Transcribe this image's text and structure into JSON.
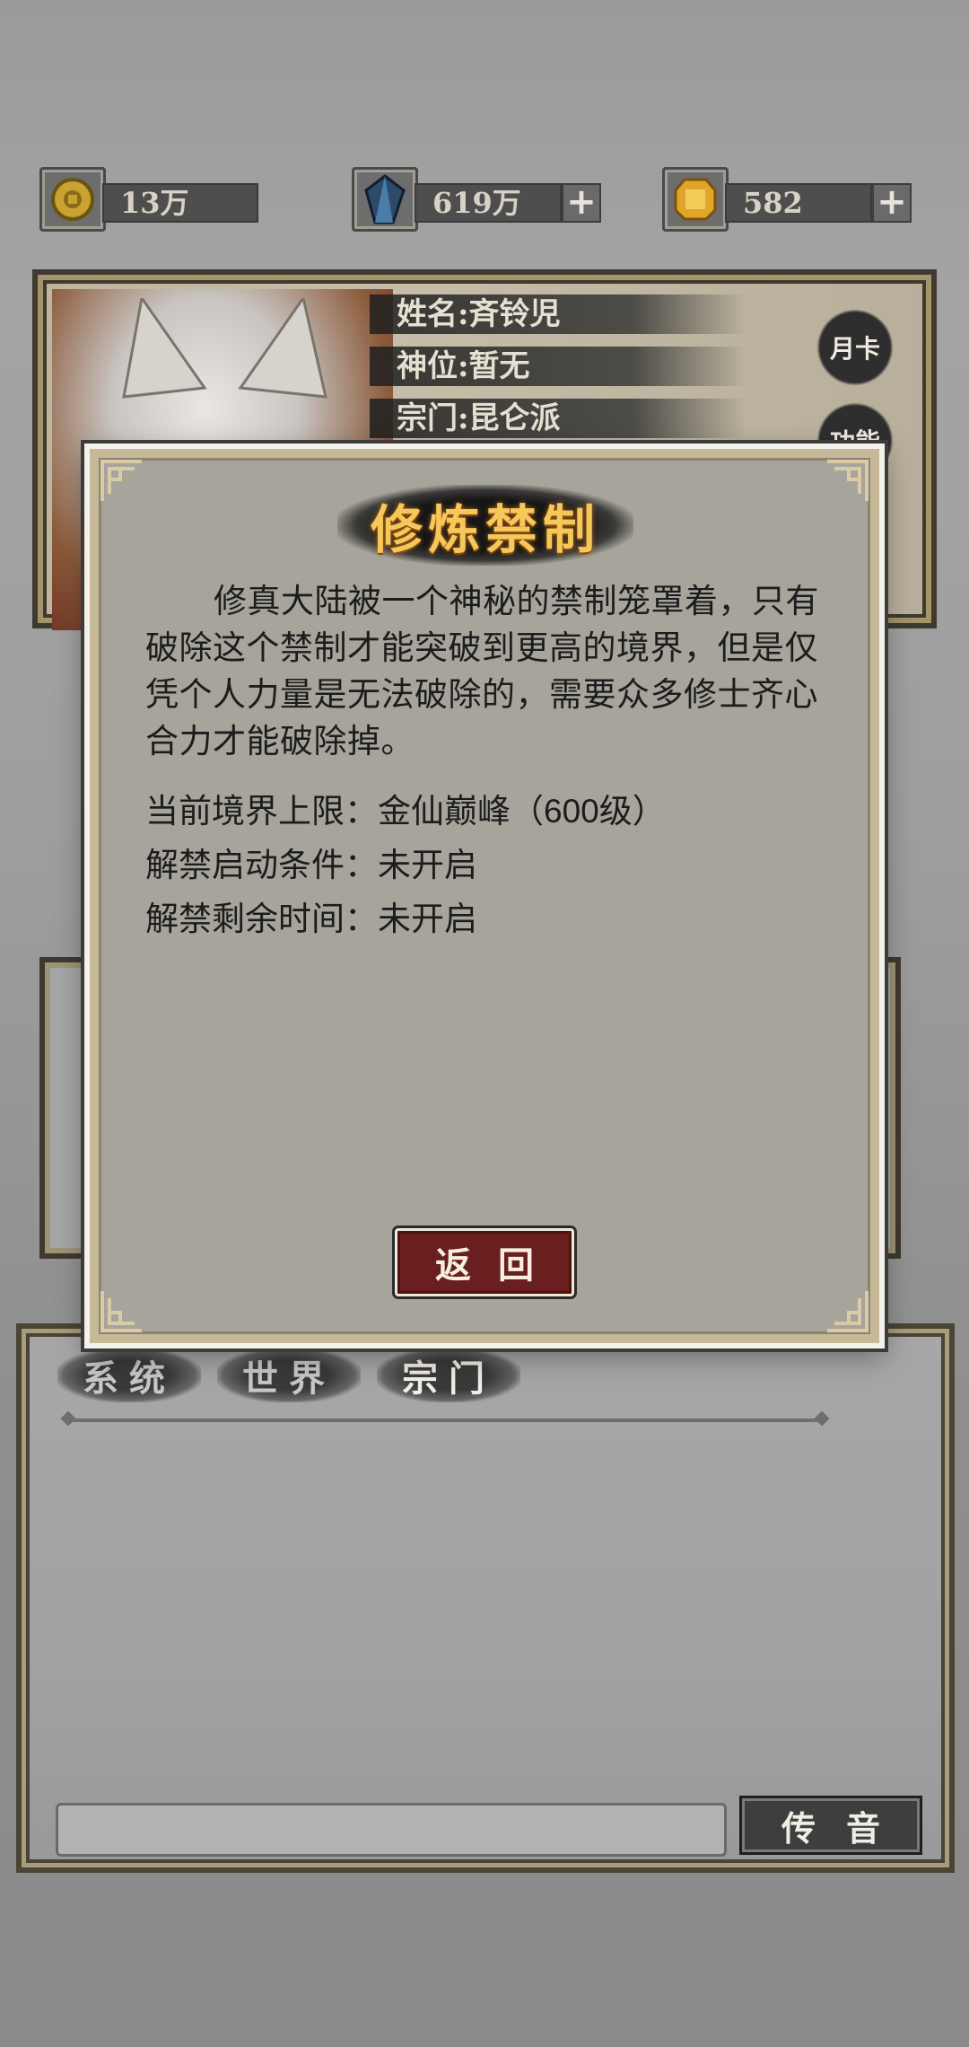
{
  "currency": {
    "coins": "13万",
    "crystals": "619万",
    "gems": "582",
    "plus_symbol": "+"
  },
  "profile": {
    "name_line": "姓名:斉铃児",
    "rank_line": "神位:暂无",
    "sect_line": "宗门:昆仑派",
    "monthly_card": "月卡",
    "functions": "功能"
  },
  "modal": {
    "title": "修炼禁制",
    "description": "修真大陆被一个神秘的禁制笼罩着，只有破除这个禁制才能突破到更高的境界，但是仅凭个人力量是无法破除的，需要众多修士齐心合力才能破除掉。",
    "rows": [
      "当前境界上限：金仙巅峰（600级）",
      "解禁启动条件：未开启",
      "解禁剩余时间：未开启"
    ],
    "back_label": "返回"
  },
  "chat": {
    "tabs": [
      "系统",
      "世界",
      "宗门"
    ],
    "input_value": "",
    "send_label": "传音"
  }
}
